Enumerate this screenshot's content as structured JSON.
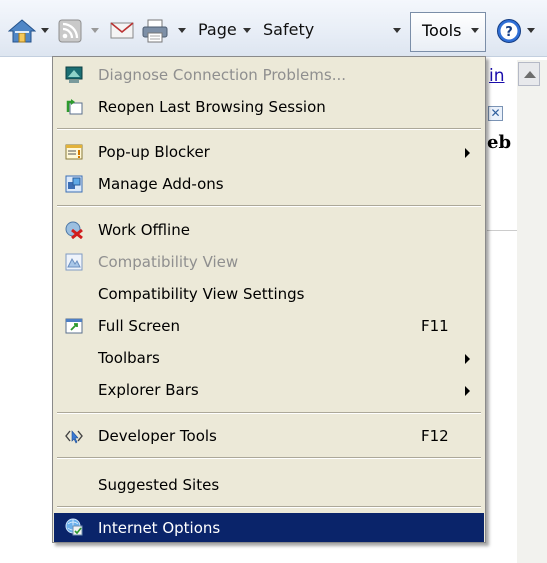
{
  "command_bar": {
    "page_label": "Page",
    "safety_label": "Safety",
    "tools_label": "Tools"
  },
  "background": {
    "link_text": "in",
    "close_glyph": "✕",
    "partial_text": "eb"
  },
  "menu": {
    "items": [
      {
        "label": "Diagnose Connection Problems...",
        "icon": "diagnose-connection-icon",
        "disabled": true
      },
      {
        "label": "Reopen Last Browsing Session",
        "icon": "reopen-session-icon"
      },
      {
        "label": "Pop-up Blocker",
        "icon": "popup-blocker-icon",
        "submenu": true
      },
      {
        "label": "Manage Add-ons",
        "icon": "manage-addons-icon"
      },
      {
        "label": "Work Offline",
        "icon": "work-offline-icon"
      },
      {
        "label": "Compatibility View",
        "icon": "compatibility-view-icon",
        "disabled": true
      },
      {
        "label": "Compatibility View Settings"
      },
      {
        "label": "Full Screen",
        "icon": "full-screen-icon",
        "shortcut": "F11"
      },
      {
        "label": "Toolbars",
        "submenu": true
      },
      {
        "label": "Explorer Bars",
        "submenu": true
      },
      {
        "label": "Developer Tools",
        "icon": "developer-tools-icon",
        "shortcut": "F12"
      },
      {
        "label": "Suggested Sites"
      },
      {
        "label": "Internet Options",
        "icon": "internet-options-icon",
        "selected": true
      }
    ]
  },
  "colors": {
    "menu_background": "#ece9d8",
    "selection": "#0a246a",
    "disabled_text": "#8f8f8f"
  }
}
